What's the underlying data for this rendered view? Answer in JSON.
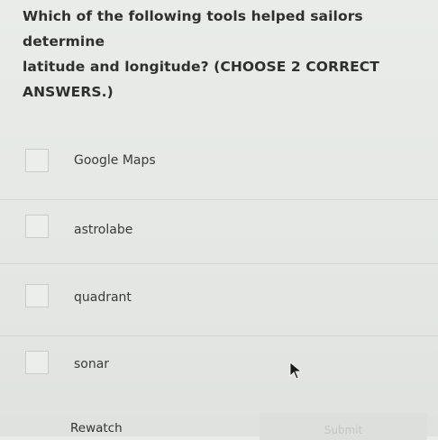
{
  "question": {
    "line1": "Which of the following tools helped sailors determine",
    "line2": "latitude and longitude? (CHOOSE 2 CORRECT",
    "line3": "ANSWERS.)"
  },
  "options": [
    {
      "label": "Google Maps",
      "checked": false
    },
    {
      "label": "astrolabe",
      "checked": false
    },
    {
      "label": "quadrant",
      "checked": false
    },
    {
      "label": "sonar",
      "checked": false
    }
  ],
  "actions": {
    "rewatch_label": "Rewatch",
    "submit_label": "Submit"
  },
  "colors": {
    "background": "#e6e9e6",
    "text": "#2f2f2f",
    "submit_disabled_text": "#c3c6c3"
  }
}
